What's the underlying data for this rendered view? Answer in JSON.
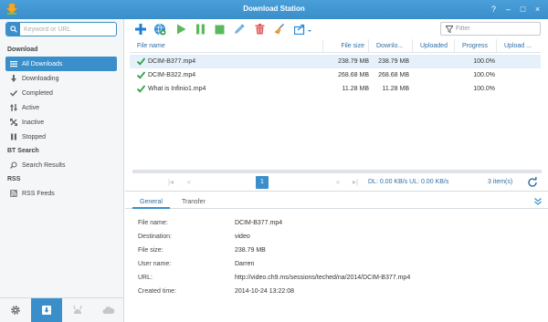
{
  "window": {
    "title": "Download Station",
    "controls": [
      "?",
      "–",
      "□",
      "×"
    ]
  },
  "sidebar": {
    "search_placeholder": "Keyword or URL",
    "sections": [
      {
        "header": "Download",
        "items": [
          {
            "label": "All Downloads",
            "icon": "list-icon",
            "active": true
          },
          {
            "label": "Downloading",
            "icon": "arrow-down-icon"
          },
          {
            "label": "Completed",
            "icon": "check-icon"
          },
          {
            "label": "Active",
            "icon": "arrows-updown-icon"
          },
          {
            "label": "Inactive",
            "icon": "arrows-cross-icon"
          },
          {
            "label": "Stopped",
            "icon": "pause-icon"
          }
        ]
      },
      {
        "header": "BT Search",
        "items": [
          {
            "label": "Search Results",
            "icon": "search-icon"
          }
        ]
      },
      {
        "header": "RSS",
        "items": [
          {
            "label": "RSS Feeds",
            "icon": "rss-icon"
          }
        ]
      }
    ],
    "bottom_buttons": [
      "gear-icon",
      "download-list-icon",
      "emule-icon",
      "cloud-icon"
    ]
  },
  "toolbar": {
    "buttons": [
      "add-icon",
      "add-url-icon",
      "resume-icon",
      "pause-icon",
      "stop-icon",
      "edit-icon",
      "delete-icon",
      "clear-icon",
      "share-icon"
    ],
    "filter_placeholder": "Filter"
  },
  "table": {
    "columns": [
      "File name",
      "File size",
      "Downlo...",
      "Uploaded",
      "Progress",
      "Upload ..."
    ],
    "rows": [
      {
        "name": "DCIM-B377.mp4",
        "size": "238.79 MB",
        "downloaded": "238.79 MB",
        "uploaded": "",
        "progress": "100.0%",
        "selected": true
      },
      {
        "name": "DCIM-B322.mp4",
        "size": "268.68 MB",
        "downloaded": "268.68 MB",
        "uploaded": "",
        "progress": "100.0%",
        "selected": false
      },
      {
        "name": "What is Infinio1.mp4",
        "size": "11.28 MB",
        "downloaded": "11.28 MB",
        "uploaded": "",
        "progress": "100.0%",
        "selected": false
      }
    ]
  },
  "pager": {
    "page": "1",
    "speed": "DL: 0.00 KB/s UL: 0.00 KB/s",
    "items": "3 item(s)"
  },
  "detail_tabs": [
    "General",
    "Transfer"
  ],
  "details": [
    {
      "label": "File name:",
      "value": "DCIM-B377.mp4"
    },
    {
      "label": "Destination:",
      "value": "video"
    },
    {
      "label": "File size:",
      "value": "238.79 MB"
    },
    {
      "label": "User name:",
      "value": "Darren"
    },
    {
      "label": "URL:",
      "value": "http://video.ch9.ms/sessions/teched/na/2014/DCIM-B377.mp4"
    },
    {
      "label": "Created time:",
      "value": "2014-10-24 13:22:08"
    }
  ],
  "colors": {
    "accent": "#3a8fcb",
    "header_text": "#2d6ea7",
    "success": "#2ea043"
  }
}
